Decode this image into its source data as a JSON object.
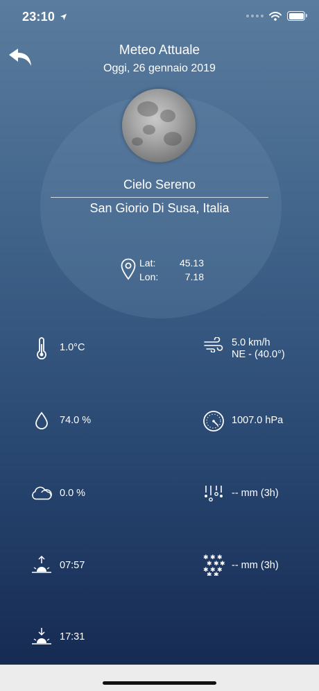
{
  "status_bar": {
    "time": "23:10"
  },
  "header": {
    "title": "Meteo Attuale",
    "date": "Oggi, 26 gennaio 2019"
  },
  "current": {
    "condition": "Cielo Sereno",
    "location": "San Giorio Di Susa, Italia"
  },
  "coordinates": {
    "lat_label": "Lat:",
    "lat_value": "45.13",
    "lon_label": "Lon:",
    "lon_value": "7.18"
  },
  "metrics": {
    "temperature": "1.0°C",
    "wind_speed": "5.0 km/h",
    "wind_direction": "NE - (40.0°)",
    "humidity": "74.0 %",
    "pressure": "1007.0 hPa",
    "cloudiness": "0.0 %",
    "rain": "-- mm (3h)",
    "sunrise": "07:57",
    "snow": "-- mm (3h)",
    "sunset": "17:31"
  },
  "icons": {
    "back": "back-arrow-icon",
    "pin": "location-pin-icon",
    "temperature": "thermometer-icon",
    "wind": "wind-icon",
    "humidity": "water-drop-icon",
    "pressure": "barometer-icon",
    "cloud": "cloud-icon",
    "rain": "rain-icon",
    "sunrise": "sunrise-icon",
    "snow": "snowflakes-icon",
    "sunset": "sunset-icon"
  }
}
